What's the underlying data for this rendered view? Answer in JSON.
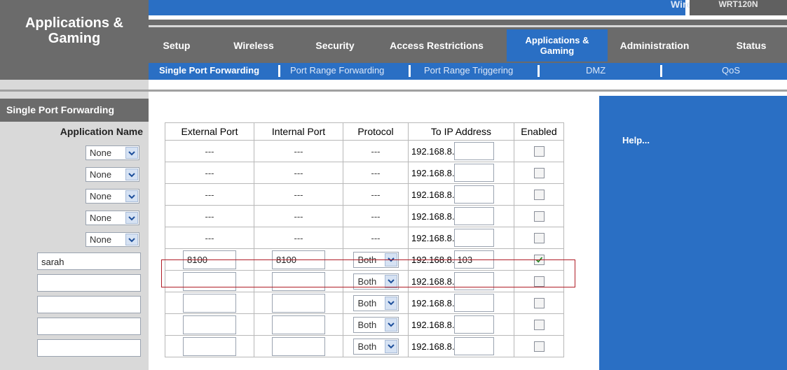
{
  "header": {
    "section_title": "Applications &\nGaming",
    "brand_text": "Wireless-N Home Router",
    "model": "WRT120N"
  },
  "tabs": [
    {
      "label": "Setup",
      "active": false
    },
    {
      "label": "Wireless",
      "active": false
    },
    {
      "label": "Security",
      "active": false
    },
    {
      "label": "Access Restrictions",
      "active": false
    },
    {
      "label": "Applications &\nGaming",
      "active": true
    },
    {
      "label": "Administration",
      "active": false
    },
    {
      "label": "Status",
      "active": false
    }
  ],
  "subtabs": [
    {
      "label": "Single Port Forwarding",
      "active": true
    },
    {
      "label": "Port Range Forwarding",
      "active": false
    },
    {
      "label": "Port Range Triggering",
      "active": false
    },
    {
      "label": "DMZ",
      "active": false
    },
    {
      "label": "QoS",
      "active": false
    }
  ],
  "sidebar": {
    "section_label": "Single Port Forwarding",
    "app_name_header": "Application Name"
  },
  "table": {
    "columns": [
      "External Port",
      "Internal Port",
      "Protocol",
      "To IP Address",
      "Enabled"
    ],
    "ip_prefix": "192.168.8.",
    "placeholder_dash": "---",
    "rows": [
      {
        "app": "None",
        "app_type": "select",
        "external": "---",
        "internal": "---",
        "protocol": "---",
        "ip_last": "",
        "enabled": false
      },
      {
        "app": "None",
        "app_type": "select",
        "external": "---",
        "internal": "---",
        "protocol": "---",
        "ip_last": "",
        "enabled": false
      },
      {
        "app": "None",
        "app_type": "select",
        "external": "---",
        "internal": "---",
        "protocol": "---",
        "ip_last": "",
        "enabled": false
      },
      {
        "app": "None",
        "app_type": "select",
        "external": "---",
        "internal": "---",
        "protocol": "---",
        "ip_last": "",
        "enabled": false
      },
      {
        "app": "None",
        "app_type": "select",
        "external": "---",
        "internal": "---",
        "protocol": "---",
        "ip_last": "",
        "enabled": false
      },
      {
        "app": "sarah",
        "app_type": "input",
        "external": "8100",
        "internal": "8100",
        "protocol": "Both",
        "ip_last": "103",
        "enabled": true
      },
      {
        "app": "",
        "app_type": "input",
        "external": "",
        "internal": "",
        "protocol": "Both",
        "ip_last": "",
        "enabled": false
      },
      {
        "app": "",
        "app_type": "input",
        "external": "",
        "internal": "",
        "protocol": "Both",
        "ip_last": "",
        "enabled": false
      },
      {
        "app": "",
        "app_type": "input",
        "external": "",
        "internal": "",
        "protocol": "Both",
        "ip_last": "",
        "enabled": false
      },
      {
        "app": "",
        "app_type": "input",
        "external": "",
        "internal": "",
        "protocol": "Both",
        "ip_last": "",
        "enabled": false
      }
    ]
  },
  "help": {
    "link_label": "Help..."
  },
  "colors": {
    "accent_blue": "#2a6fc4",
    "header_grey": "#6b6b6b",
    "highlight_red": "#b01c26"
  }
}
